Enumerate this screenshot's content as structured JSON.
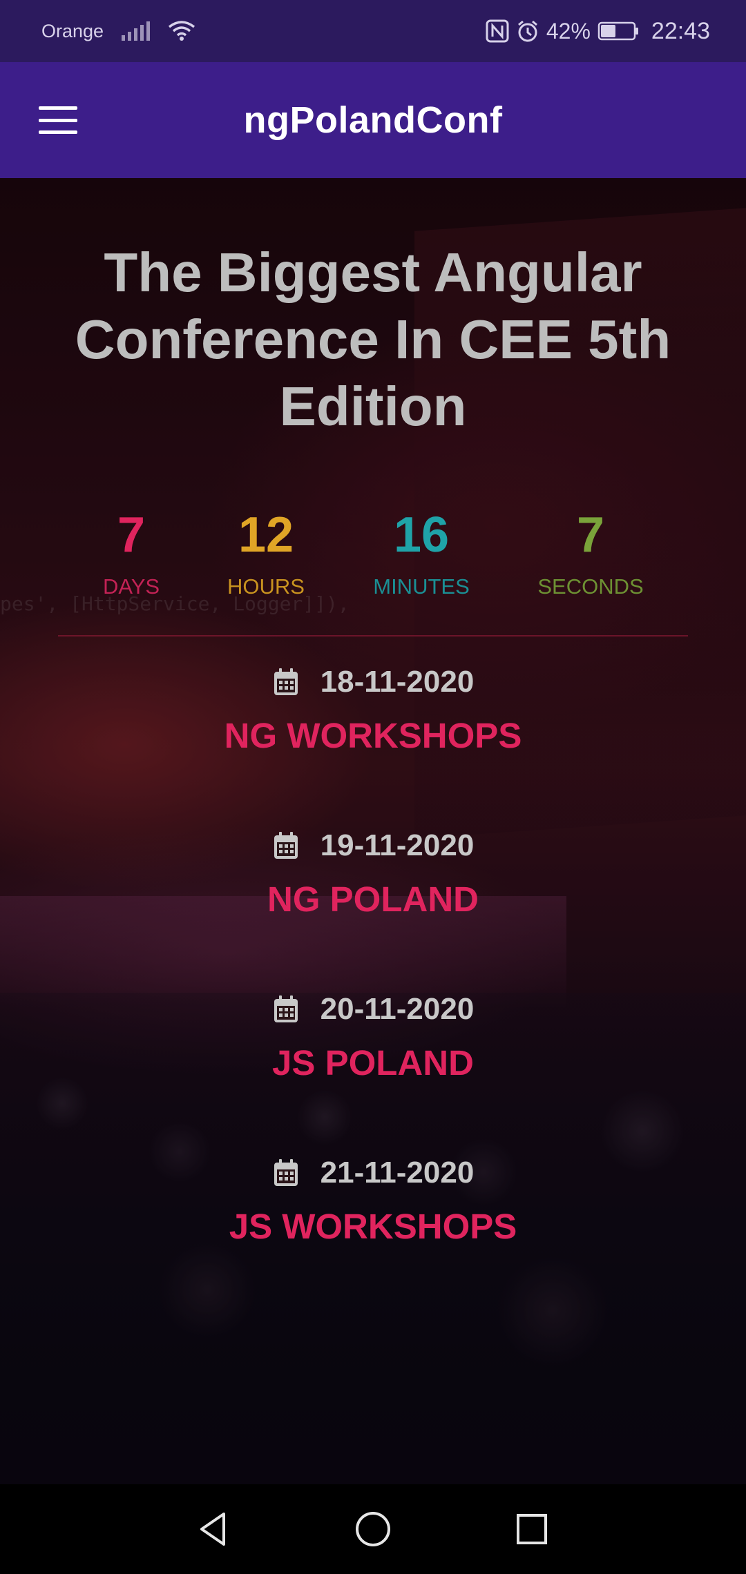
{
  "status_bar": {
    "carrier": "Orange",
    "battery": "42%",
    "time": "22:43",
    "icons": [
      "signal-icon",
      "wifi-icon",
      "nfc-icon",
      "alarm-icon",
      "battery-icon"
    ]
  },
  "app_bar": {
    "title": "ngPolandConf",
    "menu_icon": "hamburger-menu-icon",
    "background": "#3d1e8a"
  },
  "hero": {
    "headline": "The Biggest Angular Conference In CEE 5th Edition",
    "background_code_text": "pes', [HttpService, Logger]]),"
  },
  "countdown": [
    {
      "value": "7",
      "label": "DAYS",
      "color": "#e0245e"
    },
    {
      "value": "12",
      "label": "HOURS",
      "color": "#e0a526"
    },
    {
      "value": "16",
      "label": "MINUTES",
      "color": "#1fa3a8"
    },
    {
      "value": "7",
      "label": "SECONDS",
      "color": "#7aa33a"
    }
  ],
  "events": [
    {
      "date": "18-11-2020",
      "name": "NG WORKSHOPS",
      "icon": "calendar-icon"
    },
    {
      "date": "19-11-2020",
      "name": "NG POLAND",
      "icon": "calendar-icon"
    },
    {
      "date": "20-11-2020",
      "name": "JS POLAND",
      "icon": "calendar-icon"
    },
    {
      "date": "21-11-2020",
      "name": "JS WORKSHOPS",
      "icon": "calendar-icon"
    }
  ],
  "accent_color": "#e0245e",
  "nav_bar": {
    "buttons": [
      "back-icon",
      "home-icon",
      "recents-icon"
    ]
  }
}
